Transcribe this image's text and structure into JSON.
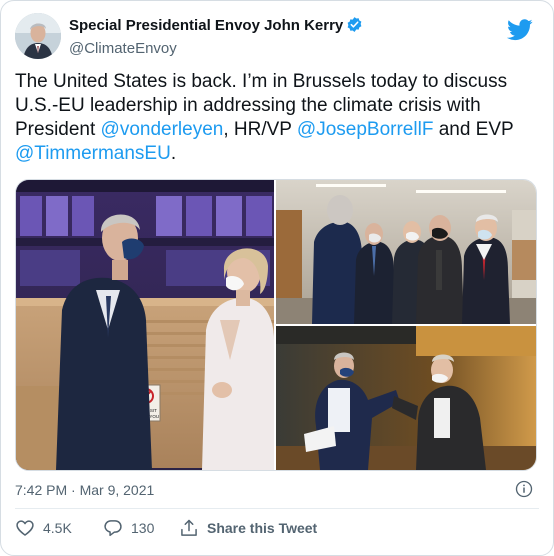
{
  "author": {
    "display_name": "Special Presidential Envoy John Kerry",
    "handle": "@ClimateEnvoy",
    "verified_icon": "verified-badge-icon",
    "avatar_icon": "avatar"
  },
  "brand": {
    "icon": "twitter-bird-icon",
    "color": "#1d9bf0"
  },
  "tweet": {
    "text_1": "The United States is back. I’m in Brussels today to discuss U.S.-EU leadership in addressing the climate crisis with President ",
    "mention_1": "@vonderleyen",
    "text_2": ", HR/VP ",
    "mention_2": "@JosepBorrellF",
    "text_3": " and EVP ",
    "mention_3": "@TimmermansEU",
    "text_4": "."
  },
  "media": {
    "photos": [
      {
        "name": "photo-kerry-von-der-leyen",
        "sign_text": "DON'T SIT\nTHANK YOU"
      },
      {
        "name": "photo-group-meeting"
      },
      {
        "name": "photo-elbow-bump"
      }
    ]
  },
  "meta": {
    "timestamp": "7:42 PM · Mar 9, 2021",
    "info_icon": "info-icon"
  },
  "actions": {
    "like_count": "4.5K",
    "reply_count": "130",
    "share_label": "Share this Tweet"
  },
  "colors": {
    "text_primary": "#0f1419",
    "text_secondary": "#536471",
    "link": "#1d9bf0",
    "border": "#d6dde3"
  }
}
